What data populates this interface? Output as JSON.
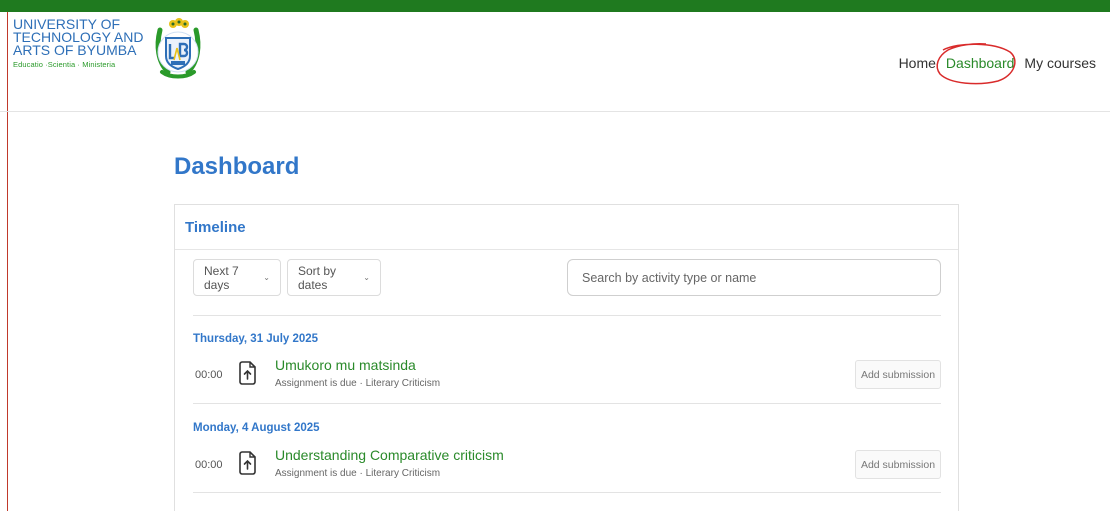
{
  "colors": {
    "accent": "#3277c9",
    "brand_green": "#2a8a2a",
    "stripe": "#1f7a1f",
    "annotation": "#d92b2b"
  },
  "brand": {
    "name_lines": [
      "UNIVERSITY OF",
      "TECHNOLOGY AND",
      "ARTS OF BYUMBA"
    ],
    "motto": "Educatio ·Scientia · Ministeria",
    "logo_icon": "university-crest-icon"
  },
  "nav": {
    "home": "Home",
    "dashboard": "Dashboard",
    "courses": "My courses"
  },
  "page": {
    "title": "Dashboard"
  },
  "timeline": {
    "title": "Timeline",
    "filter_days": "Next 7 days",
    "sort": "Sort by dates",
    "search_placeholder": "Search by activity type or name",
    "groups": [
      {
        "date": "Thursday, 31 July 2025",
        "events": [
          {
            "time": "00:00",
            "icon": "assignment-upload-icon",
            "name": "Umukoro mu matsinda",
            "meta": "Assignment is due · Literary Criticism",
            "action": "Add submission"
          }
        ]
      },
      {
        "date": "Monday, 4 August 2025",
        "events": [
          {
            "time": "00:00",
            "icon": "assignment-upload-icon",
            "name": "Understanding Comparative criticism",
            "meta": "Assignment is due · Literary Criticism",
            "action": "Add submission"
          }
        ]
      }
    ]
  }
}
